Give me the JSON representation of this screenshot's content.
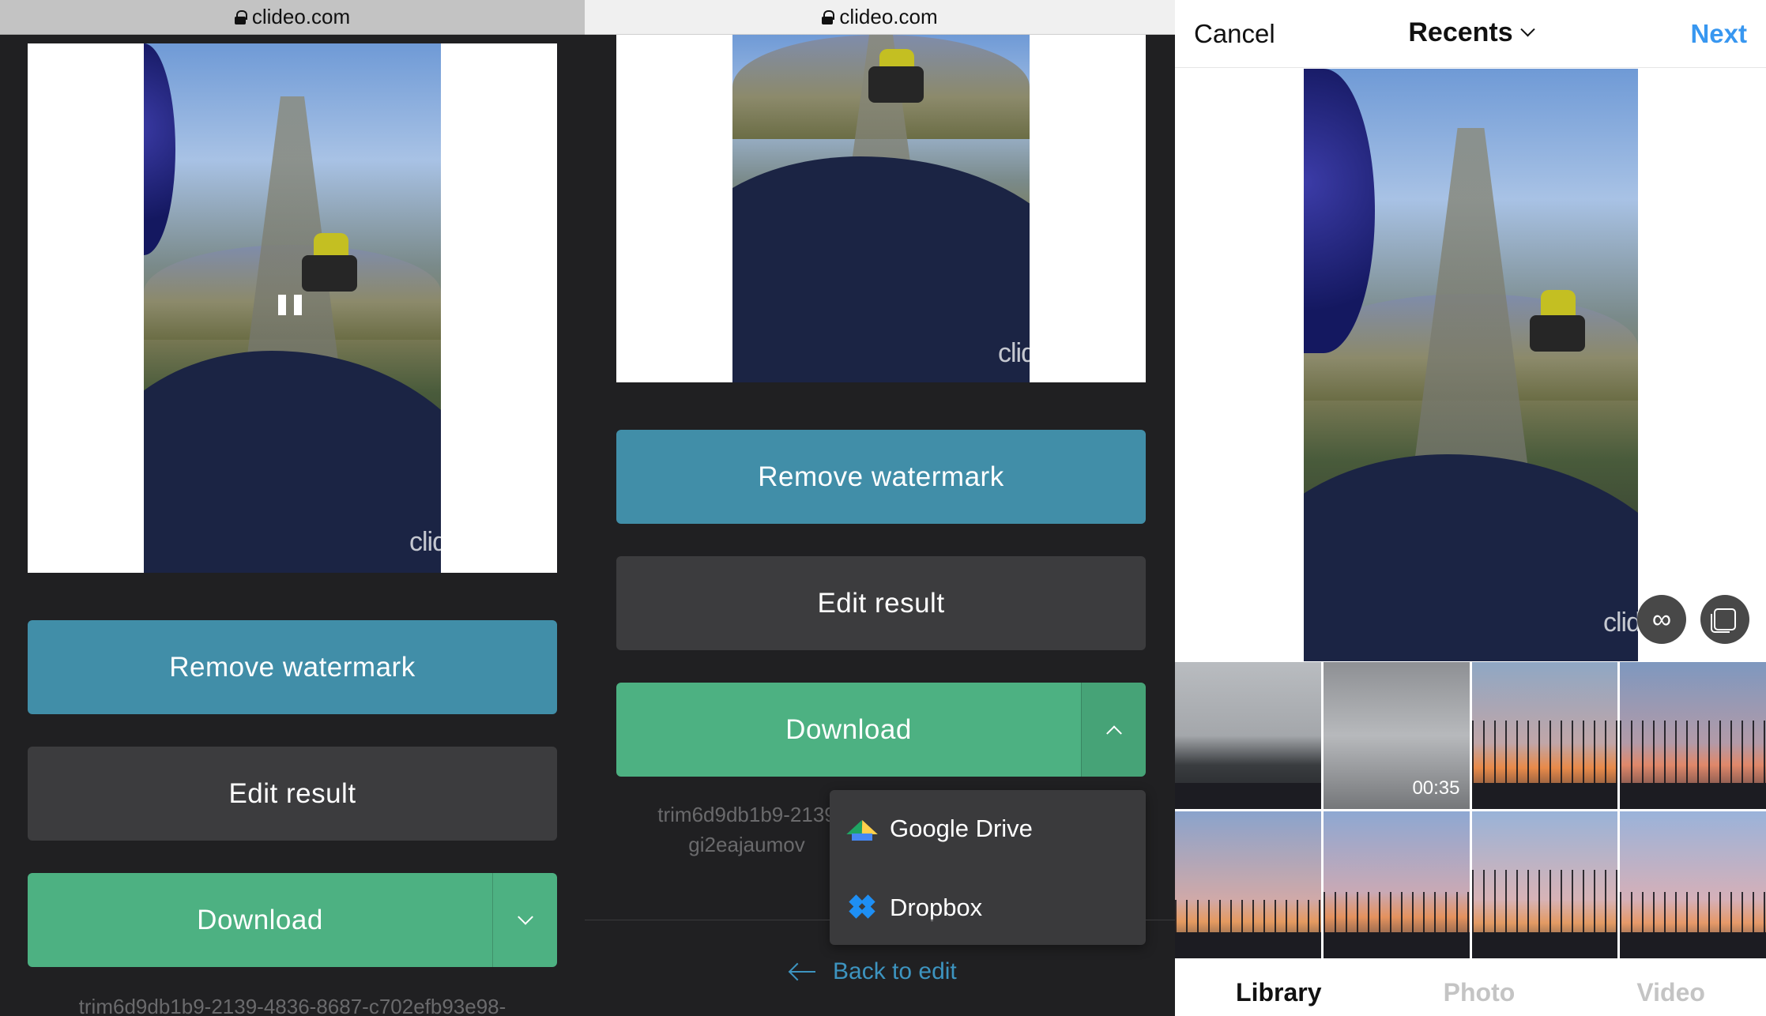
{
  "panel1": {
    "url": "clideo.com",
    "watermark": "clideo.com",
    "remove_watermark": "Remove watermark",
    "edit_result": "Edit result",
    "download": "Download",
    "filename": "trim6d9db1b9-2139-4836-8687-c702efb93e98-"
  },
  "panel2": {
    "url": "clideo.com",
    "watermark": "clideo.com",
    "remove_watermark": "Remove watermark",
    "edit_result": "Edit result",
    "download": "Download",
    "filename_line1": "trim6d9db1b9-2139",
    "filename_line2": "gi2eajaumov",
    "dropdown": [
      {
        "label": "Google Drive",
        "icon": "google-drive-icon"
      },
      {
        "label": "Dropbox",
        "icon": "dropbox-icon"
      }
    ],
    "back_to_edit": "Back to edit"
  },
  "panel3": {
    "cancel": "Cancel",
    "album": "Recents",
    "next": "Next",
    "watermark": "clideo.com",
    "boomerang_icon": "∞",
    "thumb_duration": "00:35",
    "tabs": [
      "Library",
      "Photo",
      "Video"
    ]
  },
  "colors": {
    "remove_watermark_bg": "#418ea8",
    "edit_result_bg": "#3c3c3e",
    "download_bg": "#4db182",
    "next_text": "#3897f0",
    "back_link": "#3d94c0"
  }
}
